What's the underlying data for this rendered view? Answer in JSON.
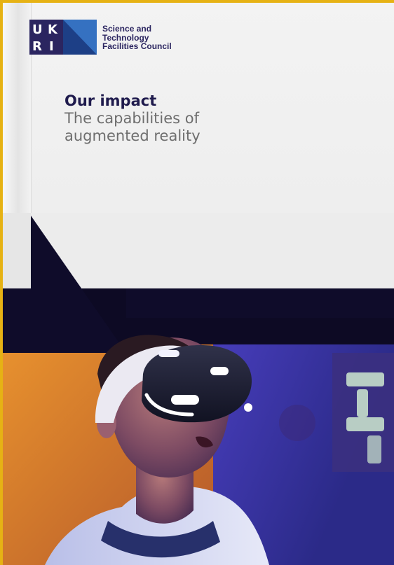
{
  "brand": {
    "logo_name": "UKRI",
    "logo_letters": [
      "U",
      "K",
      "R",
      "I"
    ],
    "council_line1": "Science and",
    "council_line2": "Technology",
    "council_line3": "Facilities Council",
    "colors": {
      "navy": "#2b2560",
      "blue": "#2d66b5",
      "accent_yellow": "#e6b214"
    }
  },
  "cover": {
    "title": "Our impact",
    "subtitle": "The capabilities of augmented reality",
    "image_subject": "Person wearing a virtual reality headset in a room lit by purple and orange light"
  }
}
